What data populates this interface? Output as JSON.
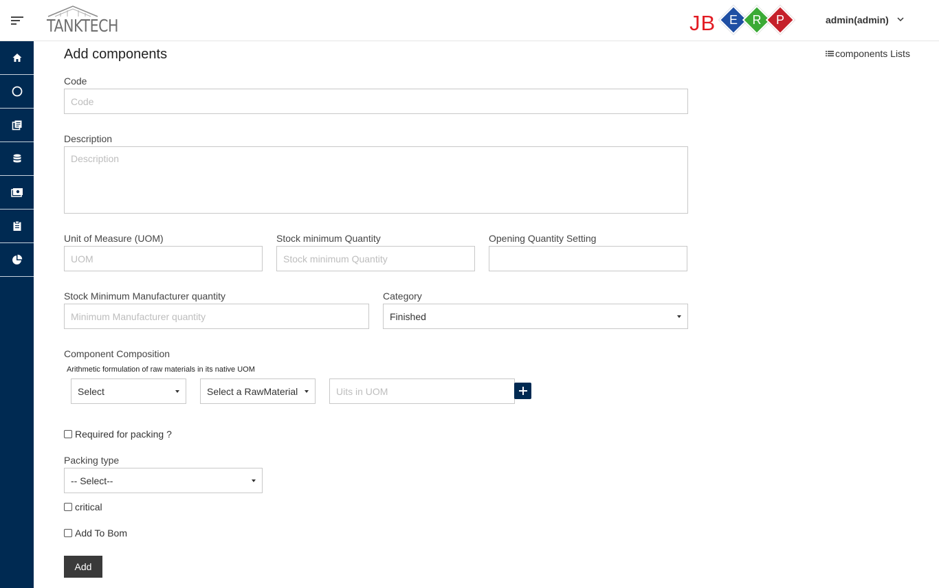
{
  "header": {
    "brand_name": "TANKTECH",
    "erp_logo": {
      "jb": "JB",
      "letters": [
        "E",
        "R",
        "P"
      ],
      "colors": [
        "#1f4fa3",
        "#3aaa35",
        "#c5202a"
      ]
    },
    "user": "admin(admin)"
  },
  "sidebar": {
    "items": [
      {
        "icon": "home-icon"
      },
      {
        "icon": "circle-icon"
      },
      {
        "icon": "books-icon"
      },
      {
        "icon": "database-icon"
      },
      {
        "icon": "money-icon"
      },
      {
        "icon": "clipboard-icon"
      },
      {
        "icon": "pie-chart-icon"
      }
    ]
  },
  "page": {
    "title": "Add components",
    "list_link": "components Lists"
  },
  "form": {
    "code": {
      "label": "Code",
      "placeholder": "Code",
      "value": ""
    },
    "description": {
      "label": "Description",
      "placeholder": "Description",
      "value": ""
    },
    "uom": {
      "label": "Unit of Measure (UOM)",
      "placeholder": "UOM",
      "value": ""
    },
    "stock_min_qty": {
      "label": "Stock minimum Quantity",
      "placeholder": "Stock minimum Quantity",
      "value": ""
    },
    "opening_qty": {
      "label": "Opening Quantity Setting",
      "placeholder": "",
      "value": ""
    },
    "min_manufacturer_qty": {
      "label": "Stock Minimum Manufacturer quantity",
      "placeholder": "Minimum Manufacturer quantity",
      "value": ""
    },
    "category": {
      "label": "Category",
      "value": "Finished"
    },
    "composition": {
      "label": "Component Composition",
      "note": "Arithmetic formulation of raw materials in its native UOM",
      "select1": "Select",
      "select2": "Select a RawMaterial",
      "units_placeholder": "Uits in UOM"
    },
    "required_packing": {
      "label": "Required for packing ?",
      "checked": false
    },
    "packing_type": {
      "label": "Packing type",
      "value": "-- Select--"
    },
    "critical": {
      "label": "critical",
      "checked": false
    },
    "add_to_bom": {
      "label": "Add To Bom",
      "checked": false
    },
    "submit_label": "Add"
  }
}
